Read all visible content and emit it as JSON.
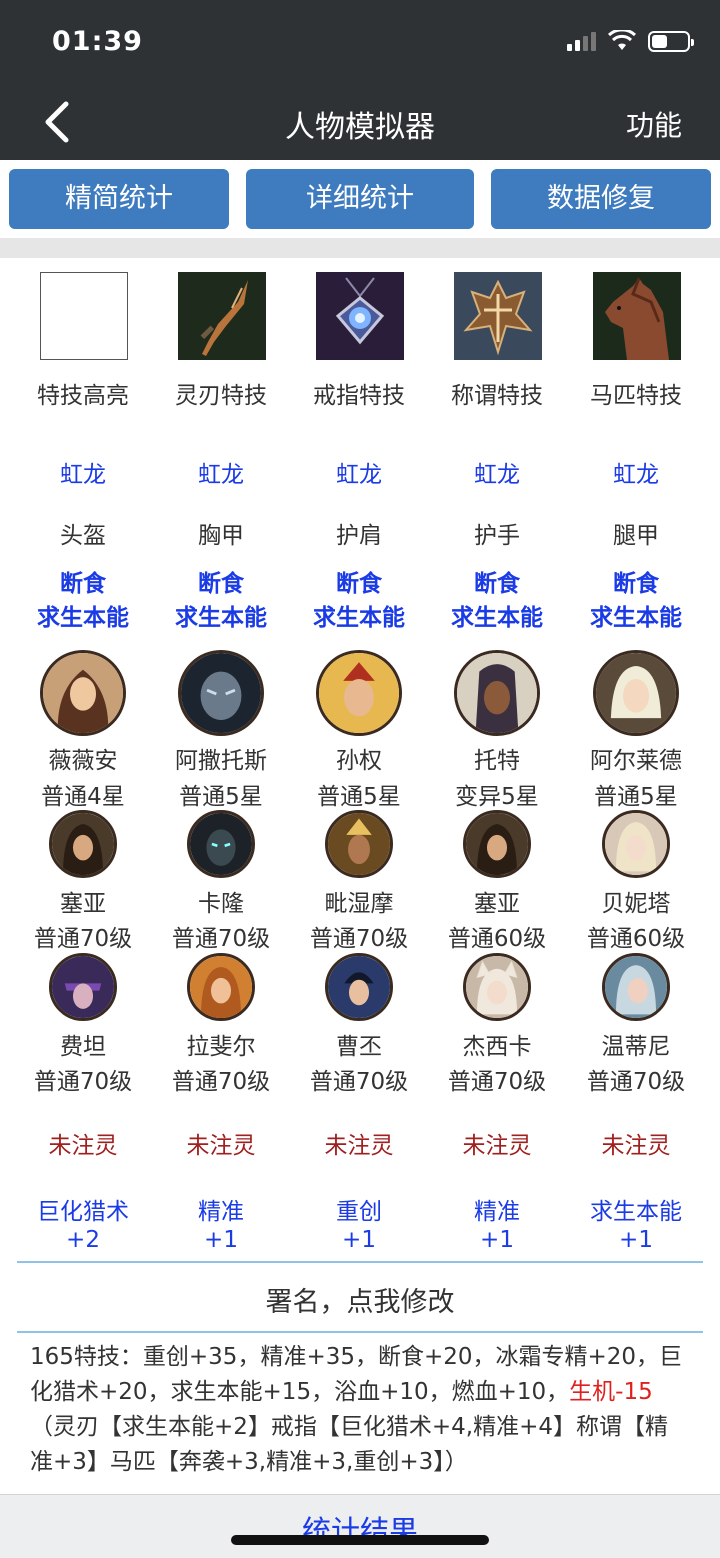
{
  "status": {
    "time": "01:39"
  },
  "nav": {
    "title": "人物模拟器",
    "function_label": "功能"
  },
  "buttons": [
    "精简统计",
    "详细统计",
    "数据修复"
  ],
  "specials": [
    {
      "label": "特技高亮",
      "icon": "blank-box-icon"
    },
    {
      "label": "灵刃特技",
      "icon": "blade-icon"
    },
    {
      "label": "戒指特技",
      "icon": "ring-icon"
    },
    {
      "label": "称谓特技",
      "icon": "title-emblem-icon"
    },
    {
      "label": "马匹特技",
      "icon": "horse-icon"
    }
  ],
  "set_names": [
    "虹龙",
    "虹龙",
    "虹龙",
    "虹龙",
    "虹龙"
  ],
  "armor": [
    {
      "slot": "头盔",
      "skill1": "断食",
      "skill2": "求生本能"
    },
    {
      "slot": "胸甲",
      "skill1": "断食",
      "skill2": "求生本能"
    },
    {
      "slot": "护肩",
      "skill1": "断食",
      "skill2": "求生本能"
    },
    {
      "slot": "护手",
      "skill1": "断食",
      "skill2": "求生本能"
    },
    {
      "slot": "腿甲",
      "skill1": "断食",
      "skill2": "求生本能"
    }
  ],
  "main_heroes": [
    {
      "name": "薇薇安",
      "rank": "普通4星"
    },
    {
      "name": "阿撒托斯",
      "rank": "普通5星"
    },
    {
      "name": "孙权",
      "rank": "普通5星"
    },
    {
      "name": "托特",
      "rank": "变异5星"
    },
    {
      "name": "阿尔莱德",
      "rank": "普通5星"
    }
  ],
  "sub_heroes_row1": [
    {
      "name": "塞亚",
      "level": "普通70级"
    },
    {
      "name": "卡隆",
      "level": "普通70级"
    },
    {
      "name": "毗湿摩",
      "level": "普通70级"
    },
    {
      "name": "塞亚",
      "level": "普通60级"
    },
    {
      "name": "贝妮塔",
      "level": "普通60级"
    }
  ],
  "sub_heroes_row2": [
    {
      "name": "费坦",
      "level": "普通70级"
    },
    {
      "name": "拉斐尔",
      "level": "普通70级"
    },
    {
      "name": "曹丕",
      "level": "普通70级"
    },
    {
      "name": "杰西卡",
      "level": "普通70级"
    },
    {
      "name": "温蒂尼",
      "level": "普通70级"
    }
  ],
  "infusion": [
    "未注灵",
    "未注灵",
    "未注灵",
    "未注灵",
    "未注灵"
  ],
  "bonuses": [
    {
      "skill": "巨化猎术",
      "value": "+2"
    },
    {
      "skill": "精准",
      "value": "+1"
    },
    {
      "skill": "重创",
      "value": "+1"
    },
    {
      "skill": "精准",
      "value": "+1"
    },
    {
      "skill": "求生本能",
      "value": "+1"
    }
  ],
  "signature": "署名，点我修改",
  "summary": {
    "main": "165特技：重创+35，精准+35，断食+20，冰霜专精+20，巨化猎术+20，求生本能+15，浴血+10，燃血+10，",
    "negative": "生机-15",
    "detail": "（灵刃【求生本能+2】戒指【巨化猎术+4,精准+4】称谓【精准+3】马匹【奔袭+3,精准+3,重创+3】）"
  },
  "result_label": "统计结果",
  "colors": {
    "header": "#2e3234",
    "button": "#3e7bbf",
    "blue_text": "#1a3be6",
    "red_text": "#e02020",
    "dark_red": "#a01f1f"
  }
}
